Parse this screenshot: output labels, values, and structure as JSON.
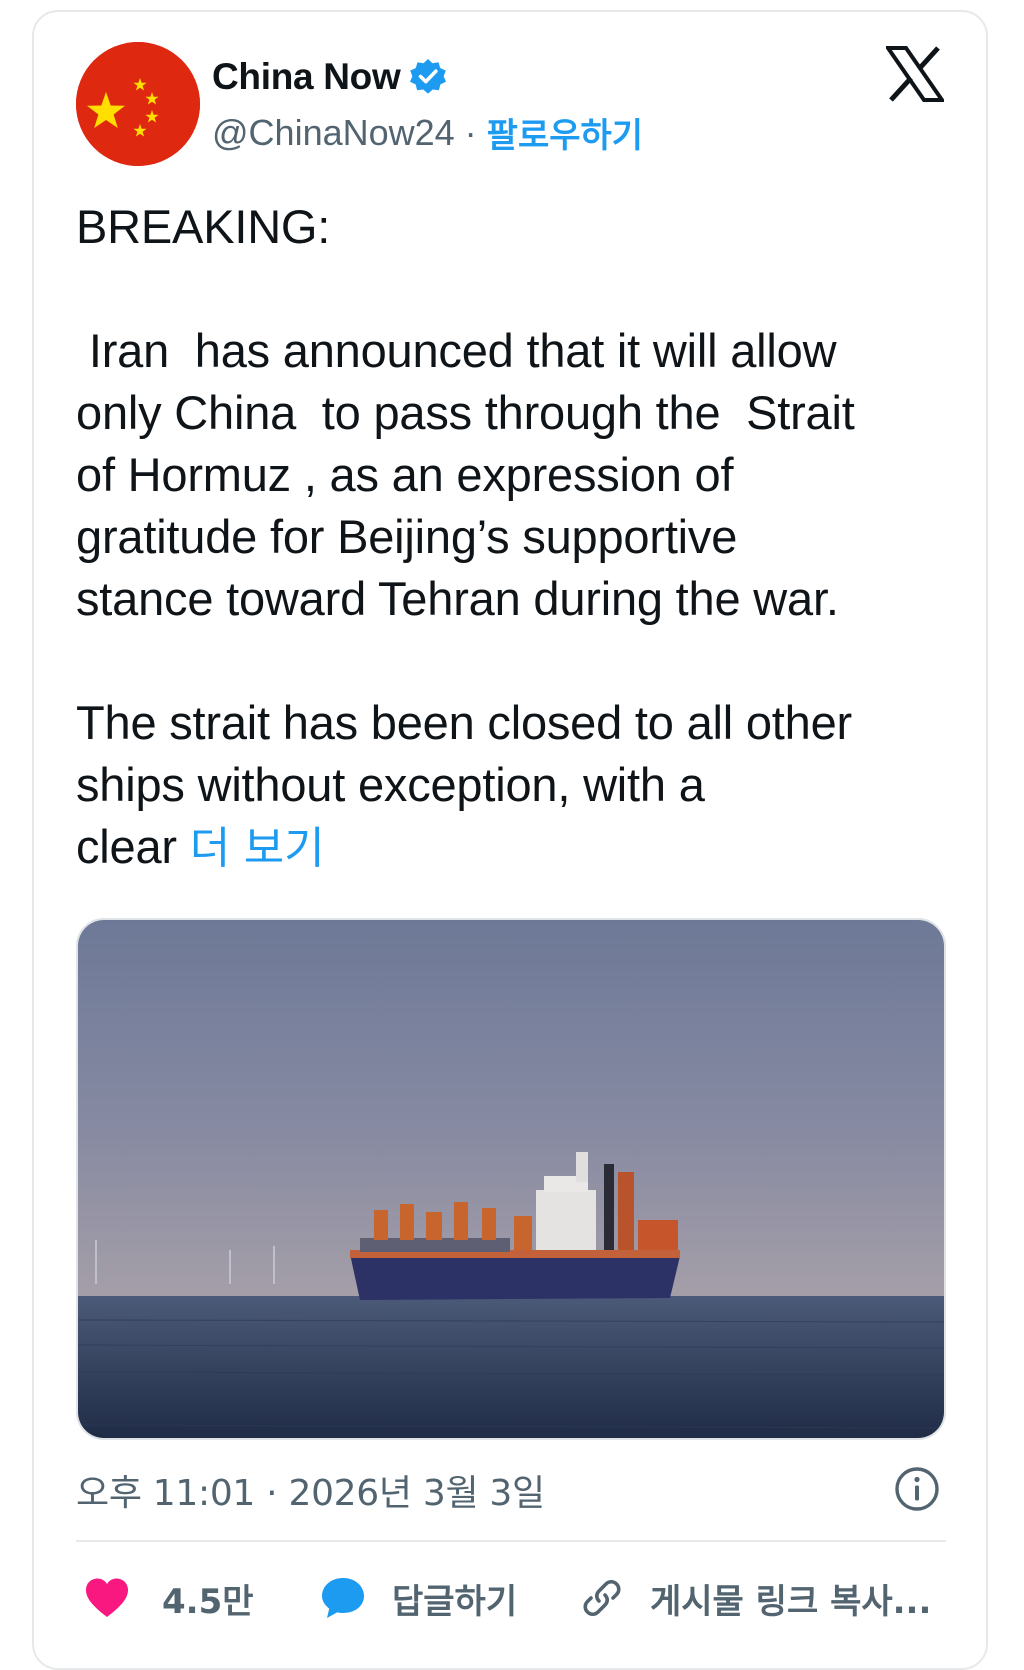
{
  "account": {
    "display_name": "China Now",
    "handle": "@ChinaNow24",
    "separator": "·",
    "follow_label": "팔로우하기",
    "verified": true
  },
  "tweet": {
    "text": "BREAKING:\n\n Iran  has announced that it will allow\nonly China  to pass through the  Strait\nof Hormuz , as an expression of\ngratitude for Beijing’s supportive\nstance toward Tehran during the war.\n\nThe strait has been closed to all other\nships without exception, with a\nclear ",
    "show_more": "더 보기",
    "timestamp": "오후 11:01 · 2026년 3월 3일"
  },
  "actions": {
    "like_count": "4.5만",
    "reply_label": "답글하기",
    "copy_link_label": "게시물 링크 복사..."
  },
  "colors": {
    "accent": "#1d9bf0",
    "like": "#f91880",
    "flag_red": "#de2910",
    "flag_yellow": "#ffde00"
  },
  "icons": [
    "verified-badge-icon",
    "x-logo-icon",
    "info-icon",
    "heart-icon",
    "reply-bubble-icon",
    "link-icon"
  ]
}
